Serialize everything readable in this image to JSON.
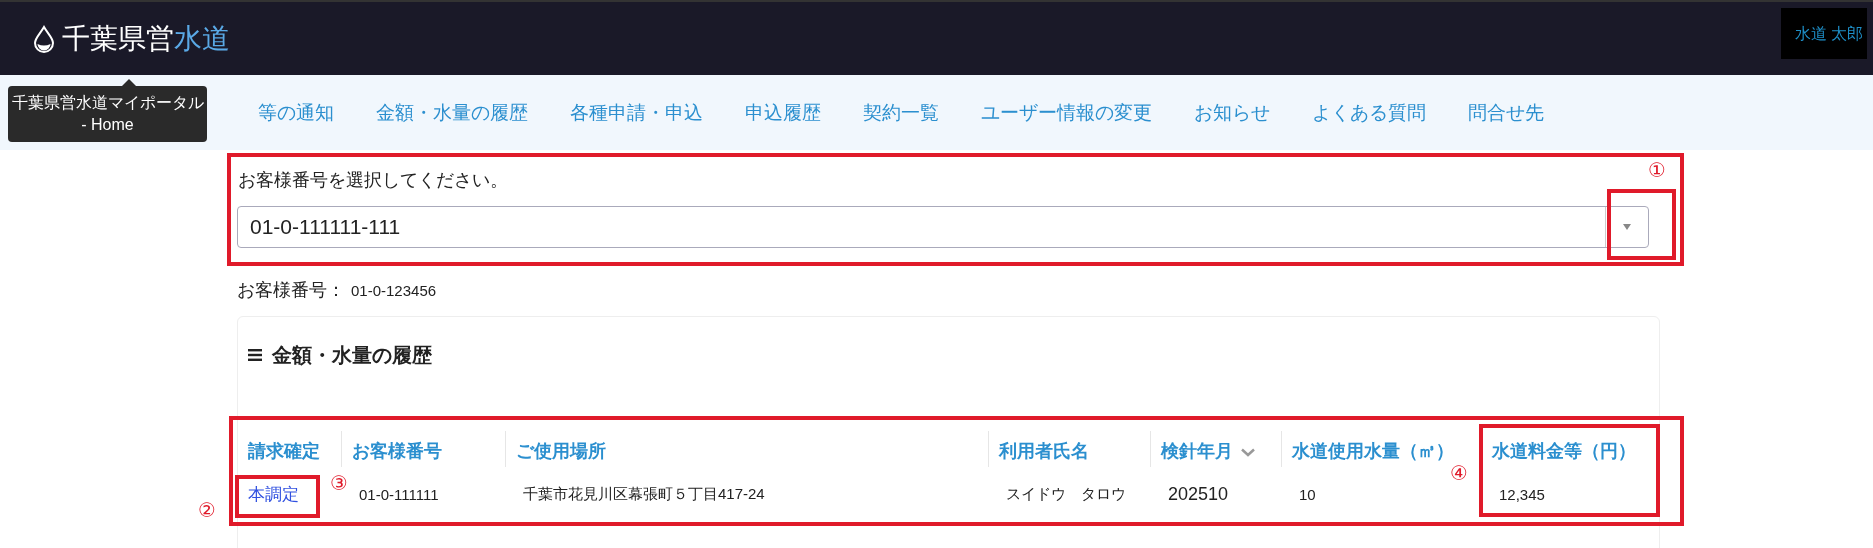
{
  "header": {
    "logo_parts": [
      {
        "text": "千葉県営",
        "highlight": false
      },
      {
        "text": "水道",
        "highlight": true
      }
    ],
    "user": "水道 太郎"
  },
  "tooltip": {
    "text": "千葉県営水道マイポータル - Home"
  },
  "nav": [
    {
      "label": "等の通知"
    },
    {
      "label": "金額・水量の履歴"
    },
    {
      "label": "各種申請・申込"
    },
    {
      "label": "申込履歴"
    },
    {
      "label": "契約一覧"
    },
    {
      "label": "ユーザー情報の変更"
    },
    {
      "label": "お知らせ"
    },
    {
      "label": "よくある質問"
    },
    {
      "label": "問合せ先"
    }
  ],
  "customer_select": {
    "label": "お客様番号を選択してください。",
    "value": "01-0-111111-111"
  },
  "customer_number": {
    "label": "お客様番号：",
    "value": "01-0-123456"
  },
  "card": {
    "title": "金額・水量の履歴",
    "table": {
      "columns": [
        {
          "label": "請求確定",
          "sorted": false
        },
        {
          "label": "お客様番号",
          "sorted": false
        },
        {
          "label": "ご使用場所",
          "sorted": false
        },
        {
          "label": "利用者氏名",
          "sorted": false
        },
        {
          "label": "検針年月",
          "sorted": true
        },
        {
          "label": "水道使用水量（㎥）",
          "sorted": false
        },
        {
          "label": "水道料金等（円）",
          "sorted": false
        }
      ],
      "rows": [
        {
          "cells": [
            "本調定",
            "01-0-111111",
            "千葉市花見川区幕張町５丁目417-24",
            "スイドウ　タロウ",
            "202510",
            "10",
            "12,345"
          ]
        }
      ]
    }
  },
  "annotations": [
    {
      "label": "①"
    },
    {
      "label": "②"
    },
    {
      "label": "③"
    },
    {
      "label": "④"
    }
  ]
}
